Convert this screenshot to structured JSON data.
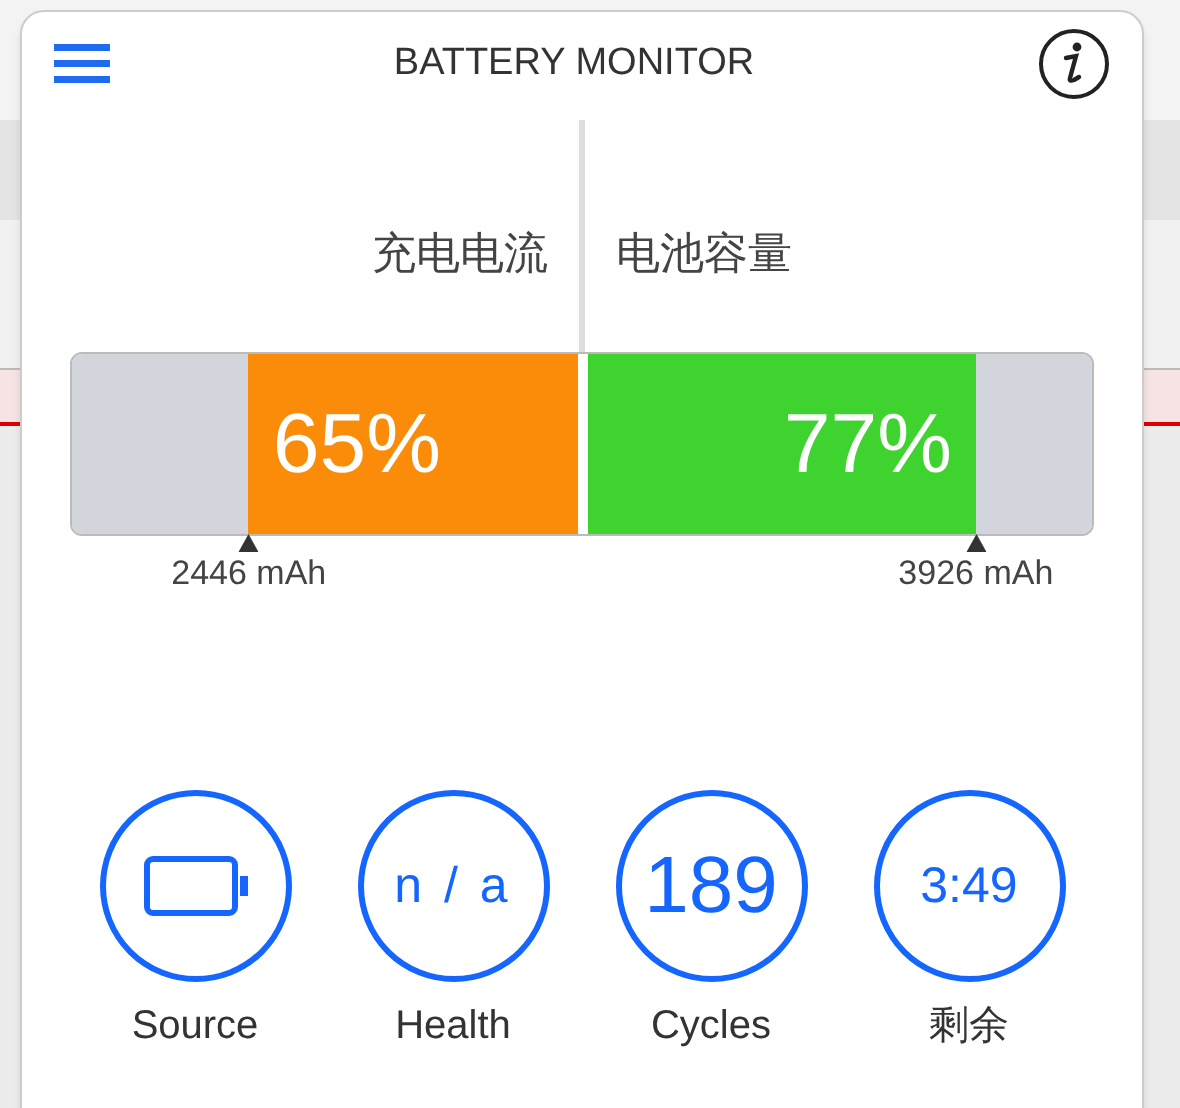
{
  "title": "BATTERY MONITOR",
  "gauges": [
    {
      "label": "充电电流",
      "kind": "end",
      "level": 0.65,
      "reading": "65%",
      "marker": "2446 mAh",
      "color": "#fb8c0a"
    },
    {
      "label": "电池容量",
      "kind": "start",
      "level": 0.77,
      "reading": "77%",
      "marker": "3926 mAh",
      "color": "#3ed32f"
    }
  ],
  "stats": [
    {
      "kind": "battery",
      "label": "Source"
    },
    {
      "kind": "small",
      "value": "n / a",
      "label": "Health"
    },
    {
      "kind": "large",
      "value": "189",
      "label": "Cycles"
    },
    {
      "kind": "medium",
      "value": "3:49",
      "label": "剩余"
    }
  ]
}
